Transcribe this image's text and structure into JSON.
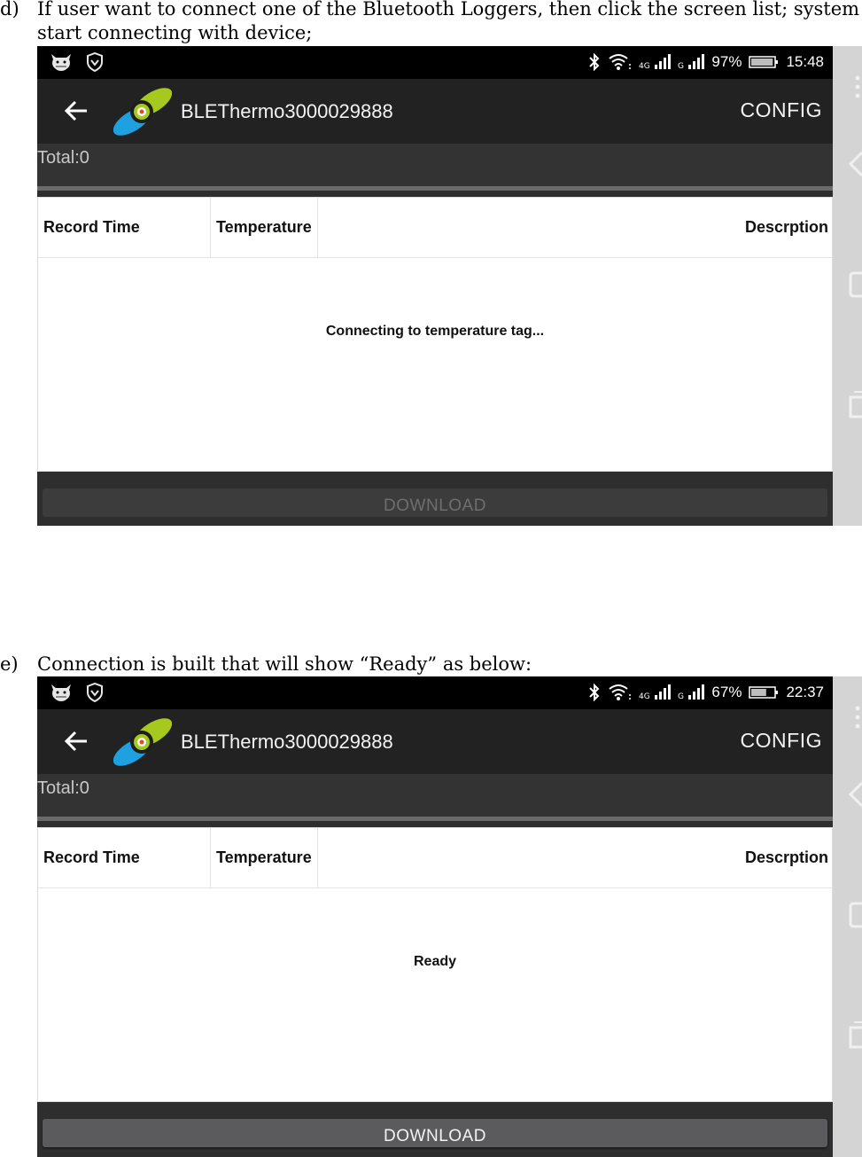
{
  "step_d": {
    "label": "d)",
    "text_line1": "If user want to connect one of the Bluetooth Loggers, then click the screen list; system will",
    "text_line2": "start connecting with device;"
  },
  "step_e": {
    "label": "e)",
    "text": "Connection is built that will show “Ready” as below:"
  },
  "screens": [
    {
      "status_bar": {
        "left_icons": [
          "cow-icon",
          "shield-icon"
        ],
        "right_icons": [
          "bluetooth-icon",
          "wifi-icon",
          "4g-signal-icon",
          "g-signal-icon",
          "battery-icon"
        ],
        "battery_percent": "97%",
        "battery_level": 0.97,
        "time": "15:48"
      },
      "app_bar": {
        "back_icon": "back-arrow-icon",
        "logo": "app-logo",
        "title": "BLEThermo3000029888",
        "config_label": "CONFIG"
      },
      "total_label": "Total:0",
      "table": {
        "columns": [
          "Record Time",
          "Temperature",
          "Descrption"
        ],
        "rows": []
      },
      "status_message": "Connecting to temperature tag...",
      "download_label": "DOWNLOAD",
      "download_enabled": false
    },
    {
      "status_bar": {
        "left_icons": [
          "cow-icon",
          "shield-icon"
        ],
        "right_icons": [
          "bluetooth-icon",
          "wifi-icon",
          "4g-signal-icon",
          "g-signal-icon",
          "battery-icon"
        ],
        "battery_percent": "67%",
        "battery_level": 0.67,
        "time": "22:37"
      },
      "app_bar": {
        "back_icon": "back-arrow-icon",
        "logo": "app-logo",
        "title": "BLEThermo3000029888",
        "config_label": "CONFIG"
      },
      "total_label": "Total:0",
      "table": {
        "columns": [
          "Record Time",
          "Temperature",
          "Descrption"
        ],
        "rows": []
      },
      "status_message": "Ready",
      "download_label": "DOWNLOAD",
      "download_enabled": true
    }
  ],
  "nav_bar": {
    "icons": [
      "menu-dots-icon",
      "nav-back-icon",
      "nav-home-icon",
      "nav-recents-icon"
    ]
  }
}
